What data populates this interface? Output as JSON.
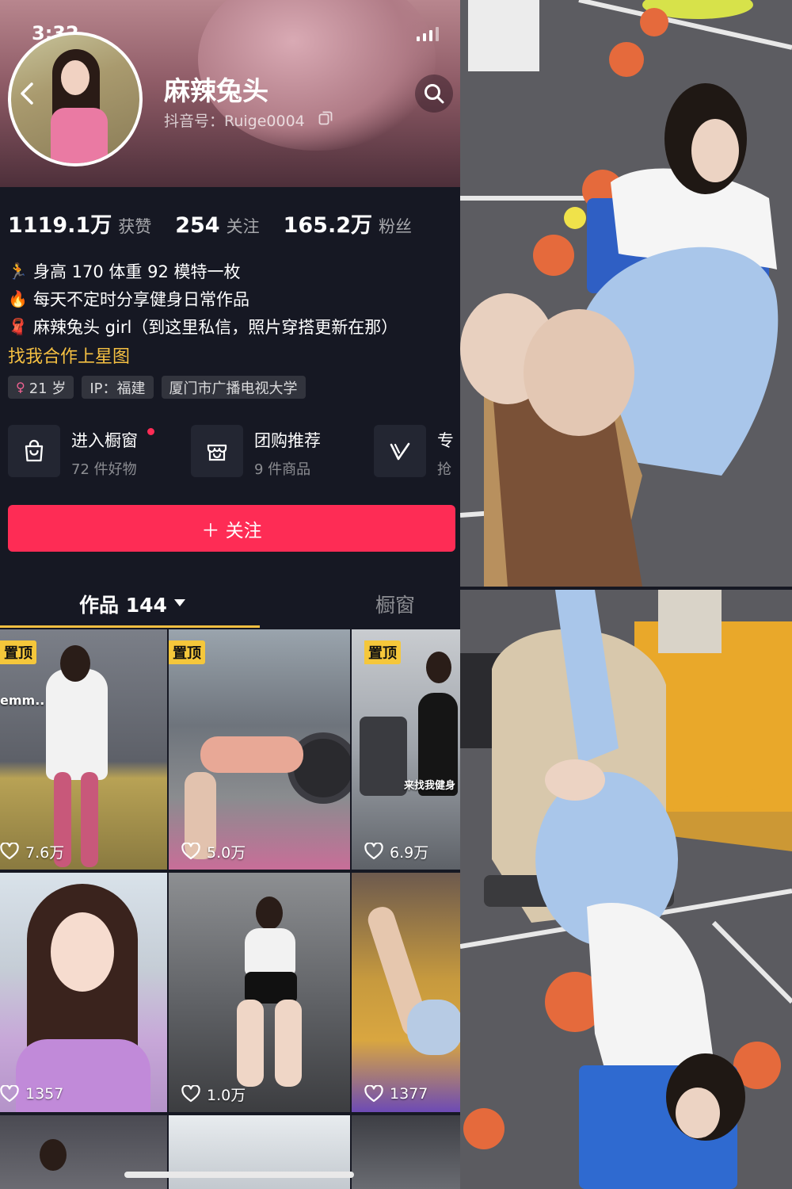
{
  "status": {
    "time": "3:32"
  },
  "profile": {
    "nickname": "麻辣兔头",
    "douyin_id": "抖音号：Ruige0004"
  },
  "stats": [
    {
      "value": "1119.1万",
      "label": "获赞"
    },
    {
      "value": "254",
      "label": "关注"
    },
    {
      "value": "165.2万",
      "label": "粉丝"
    }
  ],
  "bio": [
    {
      "emoji": "🏃",
      "text": "身高 170 体重 92 模特一枚"
    },
    {
      "emoji": "🔥",
      "text": "每天不定时分享健身日常作品"
    },
    {
      "emoji": "🧣",
      "text": "麻辣兔头 girl（到这里私信，照片穿搭更新在那）"
    }
  ],
  "coop_link": "找我合作上星图",
  "tags": {
    "age": "21 岁",
    "ip": "IP：福建",
    "school": "厦门市广播电视大学"
  },
  "services": [
    {
      "icon": "shopping-bag-icon",
      "title": "进入橱窗",
      "subtitle": "72 件好物"
    },
    {
      "icon": "group-buy-icon",
      "title": "团购推荐",
      "subtitle": "9 件商品"
    },
    {
      "icon": "vip-icon",
      "title": "专",
      "subtitle": "抢"
    }
  ],
  "follow_button": "＋ 关注",
  "tabs": {
    "works": "作品 144",
    "window": "橱窗"
  },
  "grid": [
    {
      "pinned": true,
      "badge": "置顶",
      "likes": "7.6万",
      "overlay": "emm.."
    },
    {
      "pinned": true,
      "badge": "置顶",
      "likes": "5.0万",
      "overlay": ""
    },
    {
      "pinned": true,
      "badge": "置顶",
      "likes": "6.9万",
      "overlay": "来找我健身"
    },
    {
      "pinned": false,
      "badge": "",
      "likes": "1357",
      "overlay": ""
    },
    {
      "pinned": false,
      "badge": "",
      "likes": "1.0万",
      "overlay": ""
    },
    {
      "pinned": false,
      "badge": "",
      "likes": "1377",
      "overlay": ""
    }
  ],
  "colors": {
    "accent": "#fe2c55",
    "highlight": "#f5c042",
    "background": "#161823"
  }
}
